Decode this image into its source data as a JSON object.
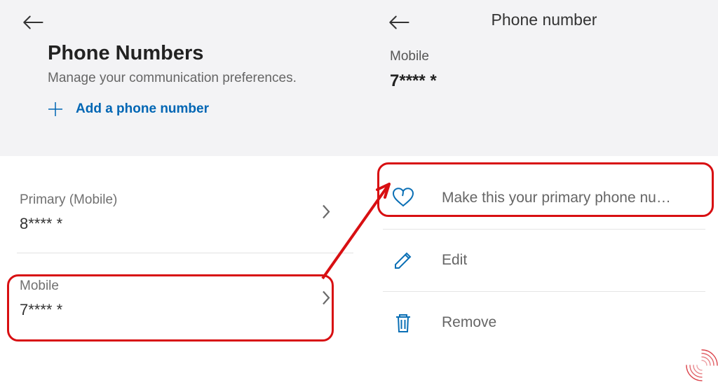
{
  "left": {
    "title": "Phone Numbers",
    "subtitle": "Manage your communication preferences.",
    "add_label": "Add a phone number",
    "rows": [
      {
        "label": "Primary (Mobile)",
        "value": "8**** *"
      },
      {
        "label": "Mobile",
        "value": "7**** *"
      }
    ]
  },
  "right": {
    "title": "Phone number",
    "detail_label": "Mobile",
    "detail_value": "7**** *",
    "actions": {
      "primary": "Make this your primary phone nu…",
      "edit": "Edit",
      "remove": "Remove"
    }
  }
}
